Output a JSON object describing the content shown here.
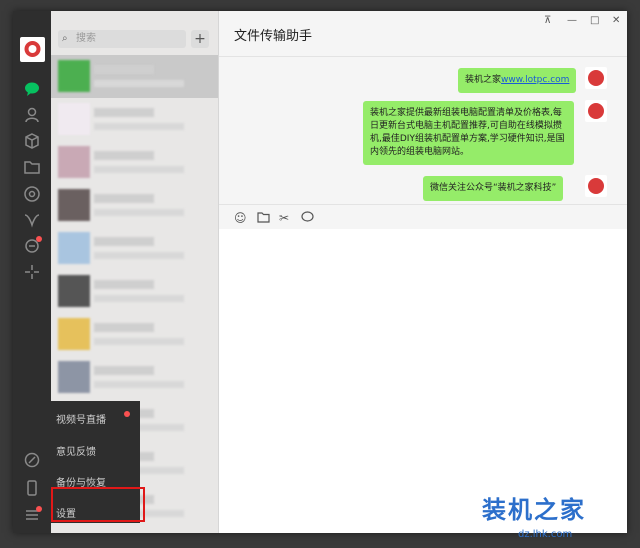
{
  "app": {
    "title": "文件传输助手"
  },
  "search": {
    "placeholder": "搜索"
  },
  "window_controls": {
    "pin": "⊼",
    "minimize": "—",
    "maximize": "□",
    "close": "✕"
  },
  "messages": [
    {
      "text_a": "装机之家",
      "link": "www.lotpc.com"
    },
    {
      "text": "装机之家提供最新组装电脑配置清单及价格表,每日更新台式电脑主机配置推荐,可自助在线模拟攒机,最佳DIY组装机配置单方案,学习硬件知识,是国内领先的组装电脑网站。"
    },
    {
      "text": "微信关注公众号“装机之家科技”"
    }
  ],
  "menu": {
    "items": [
      "视频号直播",
      "意见反馈",
      "备份与恢复",
      "设置"
    ]
  },
  "watermark": {
    "main": "装机之家",
    "sub": "dz.lhk.com"
  },
  "colors": {
    "bubble": "#95ec69",
    "accent": "#07c160",
    "highlight": "#e01818"
  }
}
